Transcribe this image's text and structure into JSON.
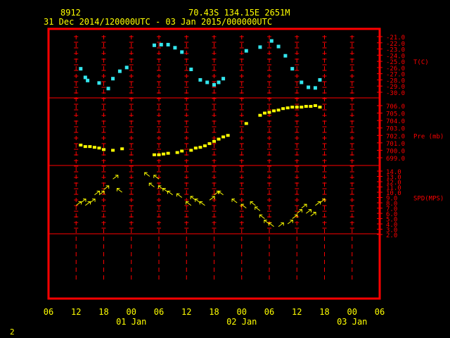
{
  "header": {
    "station_id": "8912",
    "location": "70.43S  134.15E  2651M",
    "period": "31 Dec 2014/120000UTC - 03 Jan 2015/000000UTC"
  },
  "footer": {
    "page_number": "2"
  },
  "colors": {
    "background": "#000000",
    "frame": "#ff0000",
    "text": "#ffff00",
    "temperature": "#33e6ee",
    "pressure": "#ffff00",
    "wind": "#ffff00",
    "axis_labels": "#ff0000"
  },
  "chart_data": {
    "type": "scatter",
    "x_axis": {
      "unit": "hours since 31 Dec 2014 00UTC",
      "range": [
        6,
        78
      ],
      "tick_values": [
        6,
        12,
        18,
        24,
        30,
        36,
        42,
        48,
        54,
        60,
        66,
        72,
        78
      ],
      "tick_labels": [
        "06",
        "12",
        "18",
        "00",
        "06",
        "12",
        "18",
        "00",
        "06",
        "12",
        "18",
        "00",
        "06"
      ],
      "day_labels": [
        {
          "label": "01 Jan",
          "x": 24
        },
        {
          "label": "02 Jan",
          "x": 48
        },
        {
          "label": "03 Jan",
          "x": 72
        }
      ]
    },
    "panels": [
      {
        "name": "temperature",
        "label": "T(C)",
        "ylim": [
          -30,
          -21
        ],
        "tick_labels": [
          "-21.0",
          "-22.0",
          "-23.0",
          "-24.0",
          "-25.0",
          "-26.0",
          "-27.0",
          "-28.0",
          "-29.0",
          "-30.0"
        ],
        "points": [
          [
            13,
            -26.2
          ],
          [
            14,
            -27.6
          ],
          [
            14.5,
            -28.1
          ],
          [
            17,
            -28.5
          ],
          [
            19,
            -29.4
          ],
          [
            20,
            -27.8
          ],
          [
            21.5,
            -26.6
          ],
          [
            23,
            -26.0
          ],
          [
            29,
            -22.4
          ],
          [
            30.5,
            -22.3
          ],
          [
            32,
            -22.3
          ],
          [
            33.5,
            -22.8
          ],
          [
            35,
            -23.5
          ],
          [
            37,
            -26.3
          ],
          [
            39,
            -28.0
          ],
          [
            40.5,
            -28.4
          ],
          [
            42,
            -28.8
          ],
          [
            43,
            -28.4
          ],
          [
            44,
            -27.8
          ],
          [
            49,
            -23.3
          ],
          [
            52,
            -22.7
          ],
          [
            54.5,
            -21.7
          ],
          [
            56,
            -22.6
          ],
          [
            57.5,
            -24.1
          ],
          [
            59,
            -26.2
          ],
          [
            61,
            -28.4
          ],
          [
            62.5,
            -29.2
          ],
          [
            64,
            -29.3
          ],
          [
            65,
            -28.0
          ]
        ]
      },
      {
        "name": "pressure",
        "label": "Pre (mb)",
        "ylim": [
          699,
          706
        ],
        "tick_labels": [
          "706.0",
          "705.0",
          "704.0",
          "703.0",
          "702.0",
          "701.0",
          "700.0",
          "699.0"
        ],
        "points": [
          [
            13,
            700.7
          ],
          [
            14,
            700.5
          ],
          [
            15,
            700.5
          ],
          [
            16,
            700.4
          ],
          [
            17,
            700.3
          ],
          [
            18,
            700.1
          ],
          [
            20,
            700.0
          ],
          [
            22,
            700.2
          ],
          [
            29,
            699.4
          ],
          [
            30,
            699.4
          ],
          [
            31,
            699.5
          ],
          [
            32,
            699.6
          ],
          [
            34,
            699.7
          ],
          [
            35,
            699.9
          ],
          [
            37,
            700.0
          ],
          [
            38,
            700.3
          ],
          [
            39,
            700.4
          ],
          [
            40,
            700.6
          ],
          [
            41,
            700.9
          ],
          [
            42,
            701.2
          ],
          [
            43,
            701.5
          ],
          [
            44,
            701.8
          ],
          [
            45,
            702.0
          ],
          [
            49,
            703.6
          ],
          [
            52,
            704.7
          ],
          [
            53,
            705.0
          ],
          [
            54,
            705.1
          ],
          [
            55,
            705.3
          ],
          [
            56,
            705.4
          ],
          [
            57,
            705.6
          ],
          [
            58,
            705.7
          ],
          [
            59,
            705.8
          ],
          [
            60,
            705.8
          ],
          [
            61,
            705.8
          ],
          [
            62,
            705.9
          ],
          [
            63,
            705.9
          ],
          [
            64,
            706.0
          ],
          [
            65,
            705.8
          ]
        ]
      },
      {
        "name": "wind_speed",
        "label": "SPD(MPS)",
        "ylim": [
          2,
          14
        ],
        "tick_labels": [
          "14.0",
          "13.0",
          "12.0",
          "11.0",
          "10.0",
          "9.0",
          "8.0",
          "7.0",
          "6.0",
          "5.0",
          "4.0",
          "3.0",
          "2.0"
        ],
        "arrows": [
          [
            12,
            7.5,
            "ne"
          ],
          [
            13,
            8.0,
            "ne"
          ],
          [
            14,
            7.5,
            "ne"
          ],
          [
            15,
            8.0,
            "ne"
          ],
          [
            16,
            9.5,
            "ne"
          ],
          [
            17,
            9.5,
            "ne"
          ],
          [
            18,
            10.5,
            "ne"
          ],
          [
            20,
            12.5,
            "ne"
          ],
          [
            22,
            10.0,
            "nw"
          ],
          [
            28,
            13.0,
            "nw"
          ],
          [
            29,
            11.0,
            "nw"
          ],
          [
            30,
            12.5,
            "nw"
          ],
          [
            31,
            10.5,
            "nw"
          ],
          [
            32,
            10.0,
            "nw"
          ],
          [
            33,
            9.5,
            "nw"
          ],
          [
            35,
            9.0,
            "nw"
          ],
          [
            37,
            7.5,
            "nw"
          ],
          [
            38,
            8.5,
            "nw"
          ],
          [
            39,
            8.0,
            "nw"
          ],
          [
            40,
            7.5,
            "nw"
          ],
          [
            41,
            8.5,
            "ne"
          ],
          [
            42,
            9.5,
            "ne"
          ],
          [
            44,
            9.5,
            "nw"
          ],
          [
            47,
            8.0,
            "nw"
          ],
          [
            49,
            7.0,
            "nw"
          ],
          [
            51,
            7.5,
            "nw"
          ],
          [
            52,
            6.5,
            "nw"
          ],
          [
            53,
            5.0,
            "nw"
          ],
          [
            54,
            4.0,
            "nw"
          ],
          [
            55,
            3.5,
            "nw"
          ],
          [
            56,
            3.5,
            "ne"
          ],
          [
            58,
            4.0,
            "ne"
          ],
          [
            59,
            5.0,
            "ne"
          ],
          [
            60,
            6.0,
            "ne"
          ],
          [
            61,
            7.0,
            "ne"
          ],
          [
            62,
            6.0,
            "ne"
          ],
          [
            63,
            5.5,
            "ne"
          ],
          [
            64,
            7.5,
            "ne"
          ],
          [
            65,
            8.0,
            "ne"
          ]
        ]
      }
    ]
  }
}
